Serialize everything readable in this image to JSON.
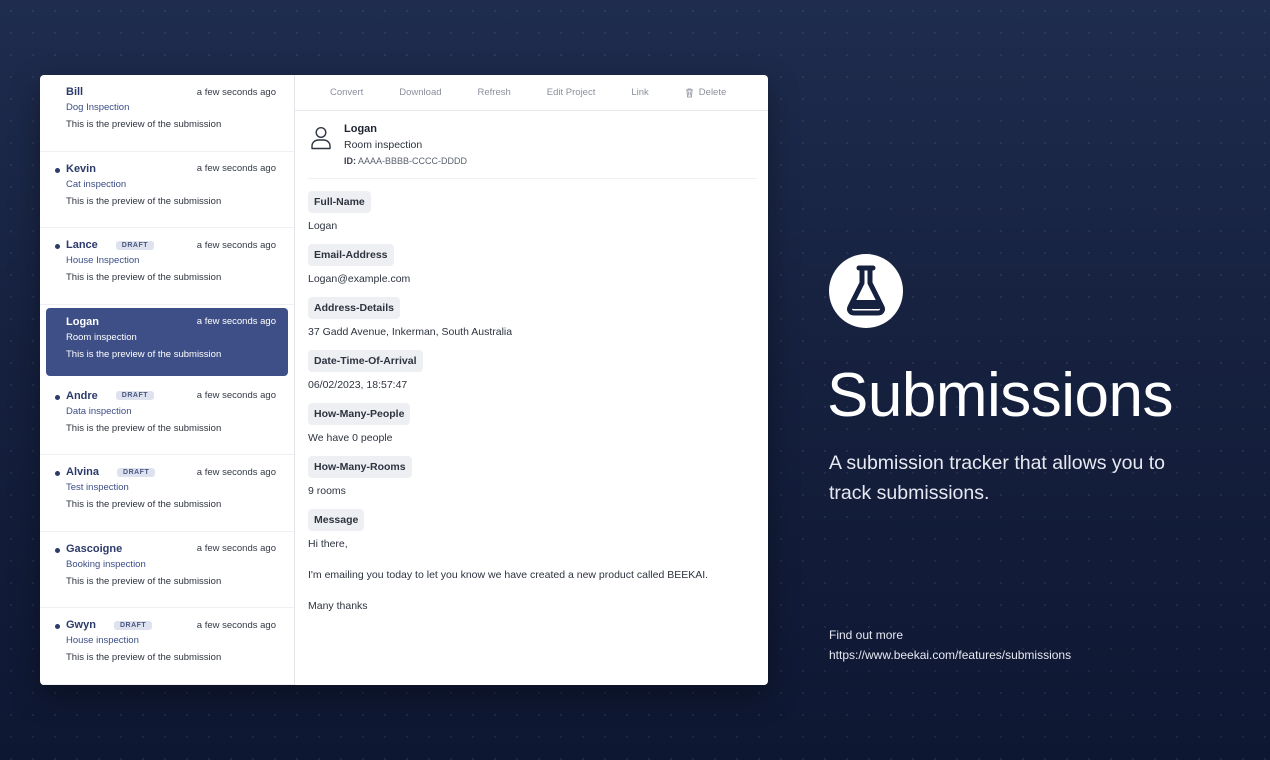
{
  "toolbar": {
    "convert": "Convert",
    "download": "Download",
    "refresh": "Refresh",
    "edit_project": "Edit Project",
    "link": "Link",
    "delete": "Delete"
  },
  "submissions": [
    {
      "name": "Bill",
      "draft": false,
      "unread": false,
      "type": "Dog Inspection",
      "time": "a few seconds ago",
      "preview": "This is the preview of the submission"
    },
    {
      "name": "Kevin",
      "draft": false,
      "unread": true,
      "type": "Cat inspection",
      "time": "a few seconds ago",
      "preview": "This is the preview of the submission"
    },
    {
      "name": "Lance",
      "draft": true,
      "unread": true,
      "type": "House Inspection",
      "time": "a few seconds ago",
      "preview": "This is the preview of the submission"
    },
    {
      "name": "Logan",
      "draft": false,
      "unread": false,
      "active": true,
      "type": "Room inspection",
      "time": "a few seconds ago",
      "preview": "This is the preview of the submission"
    },
    {
      "name": "Andre",
      "draft": true,
      "unread": true,
      "type": "Data inspection",
      "time": "a few seconds ago",
      "preview": "This is the preview of the submission"
    },
    {
      "name": "Alvina",
      "draft": true,
      "unread": true,
      "type": "Test inspection",
      "time": "a few seconds ago",
      "preview": "This is the preview of the submission"
    },
    {
      "name": "Gascoigne",
      "draft": false,
      "unread": true,
      "type": "Booking inspection",
      "time": "a few seconds ago",
      "preview": "This is the preview of the submission"
    },
    {
      "name": "Gwyn",
      "draft": true,
      "unread": true,
      "type": "House inspection",
      "time": "a few seconds ago",
      "preview": "This is the preview of the submission"
    }
  ],
  "draft_label": "DRAFT",
  "detail": {
    "name": "Logan",
    "type": "Room inspection",
    "id_label": "ID:",
    "id_value": "AAAA-BBBB-CCCC-DDDD",
    "fields": [
      {
        "label": "Full-Name",
        "value": "Logan"
      },
      {
        "label": "Email-Address",
        "value": "Logan@example.com"
      },
      {
        "label": "Address-Details",
        "value": "37 Gadd Avenue, Inkerman, South Australia"
      },
      {
        "label": "Date-Time-Of-Arrival",
        "value": "06/02/2023, 18:57:47"
      },
      {
        "label": "How-Many-People",
        "value": "We have 0 people"
      },
      {
        "label": "How-Many-Rooms",
        "value": "9 rooms"
      }
    ],
    "message_label": "Message",
    "message_lines": [
      "Hi there,",
      "I'm emailing you today to let you know we have created a new product called BEEKAI.",
      "Many thanks"
    ]
  },
  "promo": {
    "title": "Submissions",
    "subtitle": "A submission tracker that allows you to track submissions.",
    "find_more": "Find out more",
    "url": "https://www.beekai.com/features/submissions"
  },
  "colors": {
    "accent": "#3d4f86",
    "background": "#16213f"
  },
  "icons": {
    "delete": "trash-icon",
    "avatar": "user-icon",
    "logo": "flask-icon"
  }
}
